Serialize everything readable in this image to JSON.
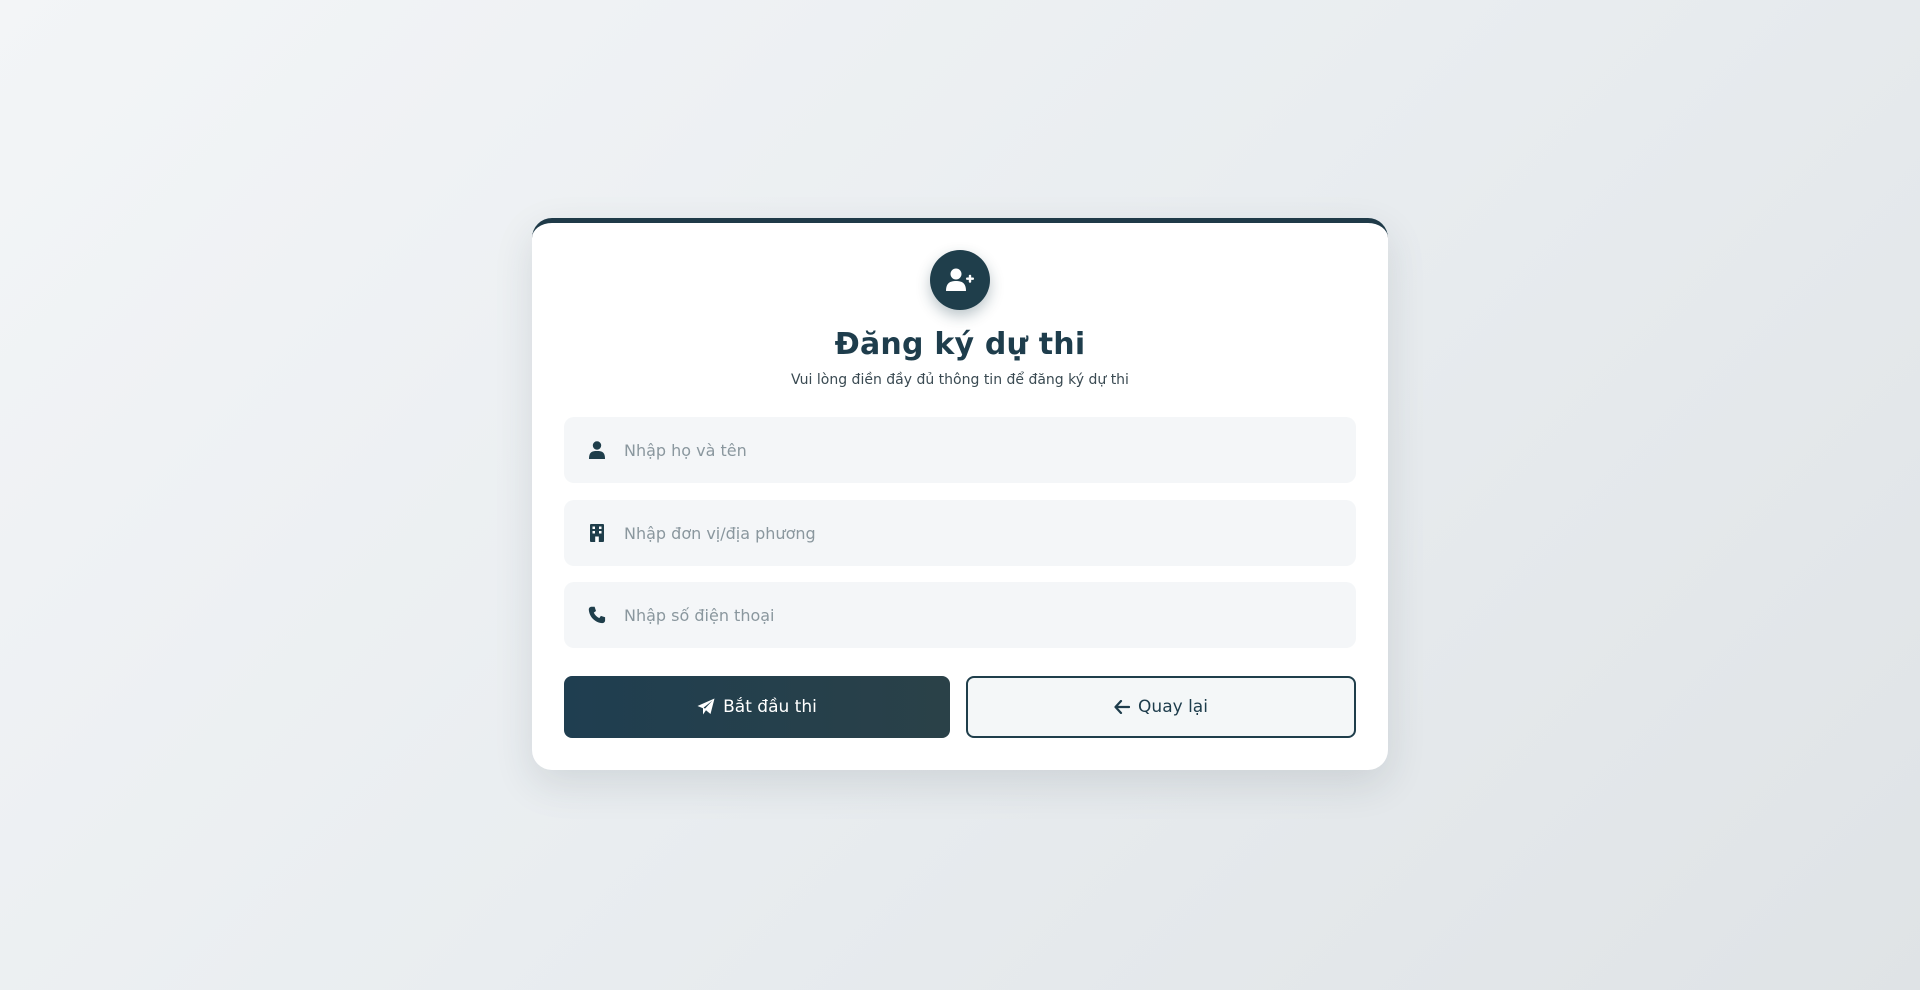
{
  "form": {
    "title": "Đăng ký dự thi",
    "subtitle": "Vui lòng điền đầy đủ thông tin để đăng ký dự thi",
    "fields": [
      {
        "icon": "user-icon",
        "placeholder": "Nhập họ và tên",
        "value": ""
      },
      {
        "icon": "building-icon",
        "placeholder": "Nhập đơn vị/địa phương",
        "value": ""
      },
      {
        "icon": "phone-icon",
        "placeholder": "Nhập số điện thoại",
        "value": ""
      }
    ],
    "start_button": {
      "label": "Bắt đầu thi",
      "icon": "paper-plane-icon"
    },
    "back_button": {
      "label": "Quay lại",
      "icon": "arrow-left-icon"
    }
  },
  "colors": {
    "primary": "#1f3e4b",
    "field_bg": "#f4f6f8",
    "card_bg": "#ffffff"
  }
}
